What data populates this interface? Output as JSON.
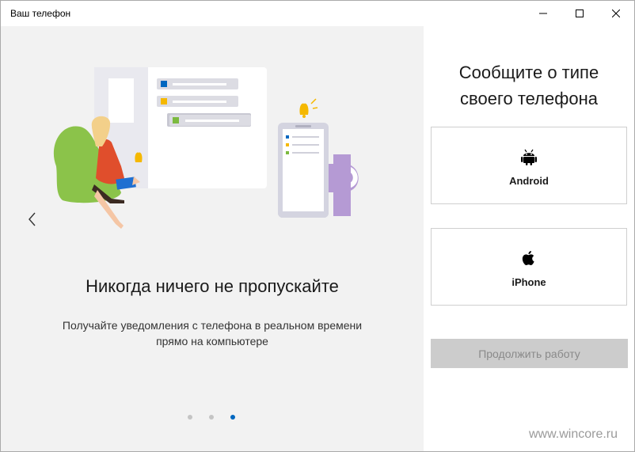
{
  "window": {
    "title": "Ваш телефон"
  },
  "slide": {
    "headline": "Никогда ничего не пропускайте",
    "description_line1": "Получайте уведомления с телефона в реальном времени",
    "description_line2": "прямо на компьютере",
    "dots_count": 3,
    "active_dot_index": 2
  },
  "panel": {
    "title_line1": "Сообщите о типе",
    "title_line2": "своего телефона",
    "android_label": "Android",
    "iphone_label": "iPhone",
    "continue_label": "Продолжить работу"
  },
  "watermark": "www.wincore.ru",
  "colors": {
    "accent": "#0067c0",
    "left_panel_bg": "#f2f2f2",
    "disabled_button_bg": "#cccccc",
    "disabled_button_text": "#8a8a8a"
  },
  "icons": {
    "android": "android-icon",
    "iphone": "apple-icon",
    "back": "chevron-left-icon"
  }
}
